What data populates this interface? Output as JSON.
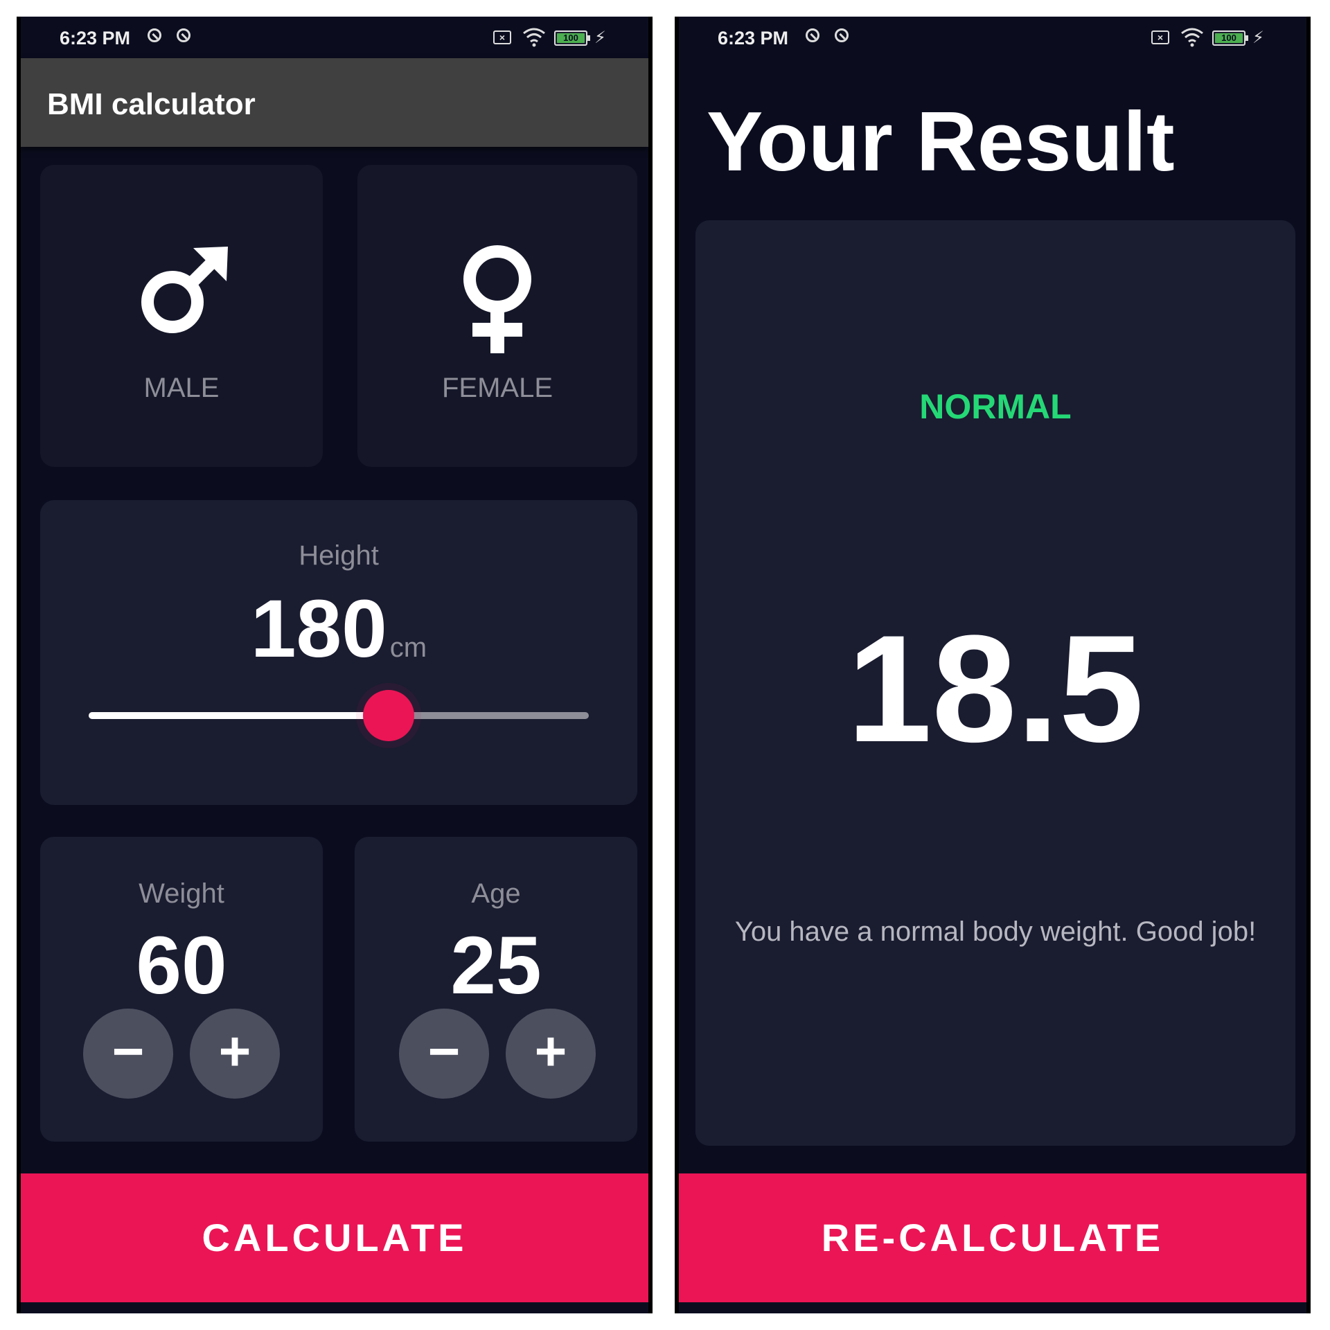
{
  "left_screen": {
    "status_bar": {
      "time": "6:23 PM",
      "battery": "100"
    },
    "app_bar": {
      "title": "BMI calculator"
    },
    "gender_cards": {
      "male": {
        "label": "MALE",
        "icon": "male-icon"
      },
      "female": {
        "label": "FEMALE",
        "icon": "female-icon"
      }
    },
    "height_card": {
      "label": "Height",
      "value": "180",
      "unit": "cm",
      "slider_fraction": 0.6
    },
    "weight_card": {
      "label": "Weight",
      "value": "60",
      "minus_label": "−",
      "plus_label": "+"
    },
    "age_card": {
      "label": "Age",
      "value": "25",
      "minus_label": "−",
      "plus_label": "+"
    },
    "bottom_button": {
      "label": "CALCULATE"
    }
  },
  "right_screen": {
    "status_bar": {
      "time": "6:23 PM",
      "battery": "100"
    },
    "title": "Your Result",
    "result": {
      "status": "NORMAL",
      "bmi": "18.5",
      "message": "You have a normal body weight. Good job!"
    },
    "bottom_button": {
      "label": "RE-CALCULATE"
    }
  },
  "colors": {
    "background": "#0b0d1f",
    "card": "#1a1c30",
    "accent": "#eb1555",
    "normal_status": "#24d876",
    "app_bar": "#404040",
    "label_grey": "#8d8e98"
  }
}
